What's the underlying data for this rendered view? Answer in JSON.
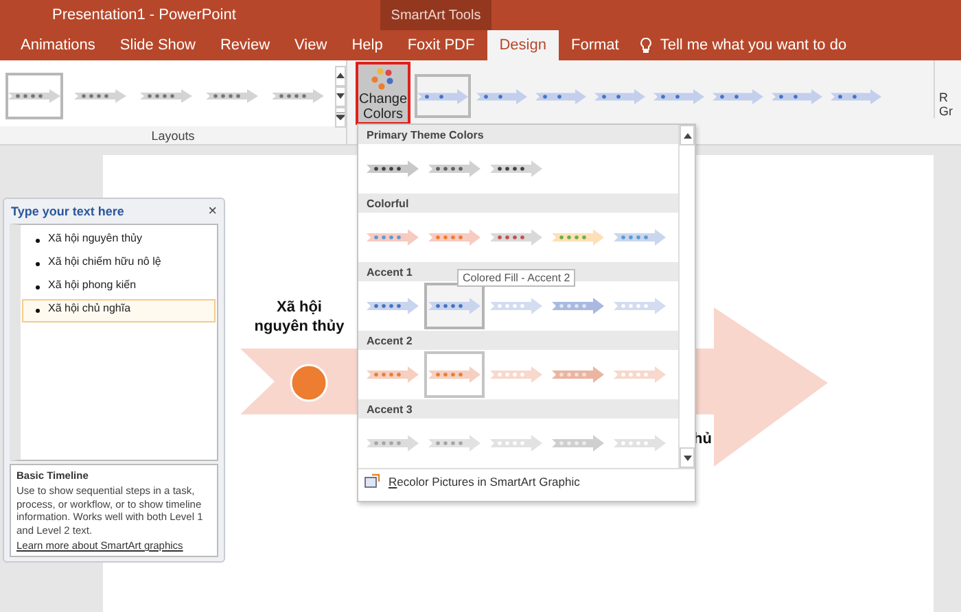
{
  "window": {
    "title": "Presentation1  -  PowerPoint",
    "contextual_group": "SmartArt Tools"
  },
  "tabs": [
    {
      "label": "Animations",
      "selected": false
    },
    {
      "label": "Slide Show",
      "selected": false
    },
    {
      "label": "Review",
      "selected": false
    },
    {
      "label": "View",
      "selected": false
    },
    {
      "label": "Help",
      "selected": false
    },
    {
      "label": "Foxit PDF",
      "selected": false
    },
    {
      "label": "Design",
      "selected": true
    },
    {
      "label": "Format",
      "selected": false
    }
  ],
  "tell_me": "Tell me what you want to do",
  "layouts": {
    "label": "Layouts",
    "items": [
      {
        "selected": true
      },
      {
        "selected": false
      },
      {
        "selected": false
      },
      {
        "selected": false
      },
      {
        "selected": false
      }
    ]
  },
  "change_colors": {
    "lines": [
      "Change",
      "Colors"
    ],
    "highlighted": true
  },
  "styles": [
    {
      "selected": true
    },
    {
      "selected": false
    },
    {
      "selected": false
    },
    {
      "selected": false
    },
    {
      "selected": false
    },
    {
      "selected": false
    },
    {
      "selected": false
    },
    {
      "selected": false
    }
  ],
  "ribbon_edge": [
    "R",
    "Gr"
  ],
  "color_menu": {
    "sections": [
      {
        "title": "Primary Theme Colors",
        "items": [
          {
            "color": "#c8c8c8",
            "dots": {
              "color": "#404040"
            },
            "selected": false
          },
          {
            "color": "#d0d0d0",
            "dots": {
              "color": "#606060"
            },
            "selected": false
          },
          {
            "color": "#d6d6d6",
            "dots": {
              "color": "#404040"
            },
            "selected": false
          }
        ]
      },
      {
        "title": "Colorful",
        "items": [
          {
            "color": "#f7cbc0",
            "dots": {
              "color": "#5b9bd5"
            },
            "selected": false
          },
          {
            "color": "#f7cbc0",
            "dots": {
              "color": "#ed7d31"
            },
            "selected": false
          },
          {
            "color": "#d9d9d9",
            "dots": {
              "color": "#c0504d"
            },
            "selected": false
          },
          {
            "color": "#fde0b8",
            "dots": {
              "color": "#70ad47"
            },
            "selected": false
          },
          {
            "color": "#c9d6ee",
            "dots": {
              "color": "#5b9bd5"
            },
            "selected": false
          }
        ]
      },
      {
        "title": "Accent 1",
        "items": [
          {
            "color": "#c9d4ee",
            "dots": {
              "color": "#4472c4"
            },
            "selected": false
          },
          {
            "color": "#c9d4ee",
            "dots": {
              "color": "#4472c4"
            },
            "selected": true
          },
          {
            "color": "#d3dcf0",
            "dots": {
              "color": "#ffffff"
            },
            "selected": false
          },
          {
            "color": "#a9b9e0",
            "dots": {
              "color": "#e0e6f4"
            },
            "selected": false
          },
          {
            "color": "#d3dcf0",
            "dots": {
              "color": "#ffffff"
            },
            "selected": false
          }
        ]
      },
      {
        "title": "Accent 2",
        "items": [
          {
            "color": "#f6cfc0",
            "dots": {
              "color": "#ed7d31"
            },
            "selected": false
          },
          {
            "color": "#f6cfc0",
            "dots": {
              "color": "#ed7d31"
            },
            "selected": false,
            "hovered": true
          },
          {
            "color": "#f8d8cc",
            "dots": {
              "color": "#ffffff"
            },
            "selected": false
          },
          {
            "color": "#eab5a2",
            "dots": {
              "color": "#f8e0d6"
            },
            "selected": false
          },
          {
            "color": "#f8d8cc",
            "dots": {
              "color": "#ffffff"
            },
            "selected": false
          }
        ]
      },
      {
        "title": "Accent 3",
        "items": [
          {
            "color": "#dcdcdc",
            "dots": {
              "color": "#a5a5a5"
            },
            "selected": false
          },
          {
            "color": "#e2e2e2",
            "dots": {
              "color": "#a5a5a5"
            },
            "selected": false
          },
          {
            "color": "#e2e2e2",
            "dots": {
              "color": "#ffffff"
            },
            "selected": false
          },
          {
            "color": "#cfcfcf",
            "dots": {
              "color": "#ededed"
            },
            "selected": false
          },
          {
            "color": "#e2e2e2",
            "dots": {
              "color": "#ffffff"
            },
            "selected": false
          }
        ]
      }
    ],
    "footer": "Recolor Pictures in SmartArt Graphic"
  },
  "tooltip": "Colored Fill - Accent 2",
  "text_pane": {
    "title": "Type your text here",
    "close": "×",
    "items": [
      {
        "text": "Xã hội nguyên thủy",
        "selected": false
      },
      {
        "text": "Xã hội chiếm hữu nô lệ",
        "selected": false
      },
      {
        "text": "Xã hội phong kiến",
        "selected": false
      },
      {
        "text": "Xã hội chủ nghĩa",
        "selected": true
      }
    ],
    "description": {
      "title": "Basic Timeline",
      "body": "Use to show sequential steps in a task, process, or workflow, or to show timeline information. Works well with both Level 1 and Level 2 text.",
      "link": "Learn more about SmartArt graphics"
    }
  },
  "slide": {
    "label": "Xã hội nguyên thủy",
    "partial_label": "hủ"
  }
}
